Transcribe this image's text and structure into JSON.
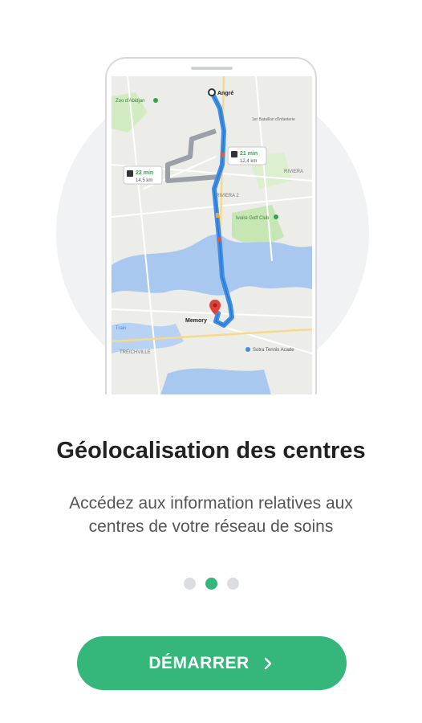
{
  "map": {
    "origin_label": "Angré",
    "destination_label": "Memory",
    "route_main": {
      "time": "21 min",
      "distance": "12,4 km"
    },
    "route_alt": {
      "time": "22 min",
      "distance": "14,5 km"
    },
    "places": {
      "zoo": "Zoo d'Abidjan",
      "battalion": "1er Bataillon d'Infanterie",
      "riviera": "RIVIERA",
      "riviera2": "RIVIERA 2",
      "golf": "Ivoire Golf Club",
      "treichville": "TREICHVILLE",
      "train": "Train",
      "tennis": "Sotra Tennis Acade"
    },
    "colors": {
      "route": "#3d8fe8",
      "alt_route": "#9aa0a6",
      "water": "#a9c8f0",
      "park": "#c6e6b3",
      "pin": "#e0423a"
    }
  },
  "onboarding": {
    "title": "Géolocalisation des centres",
    "subtitle": "Accédez aux information relatives aux centres de votre réseau de soins",
    "page_count": 3,
    "current_page": 2
  },
  "cta": {
    "label": "DÉMARRER",
    "icon": "chevron-right-icon"
  },
  "colors": {
    "accent": "#35b67a",
    "title": "#222222",
    "subtitle": "#555555",
    "dot_inactive": "#dcdde0"
  }
}
